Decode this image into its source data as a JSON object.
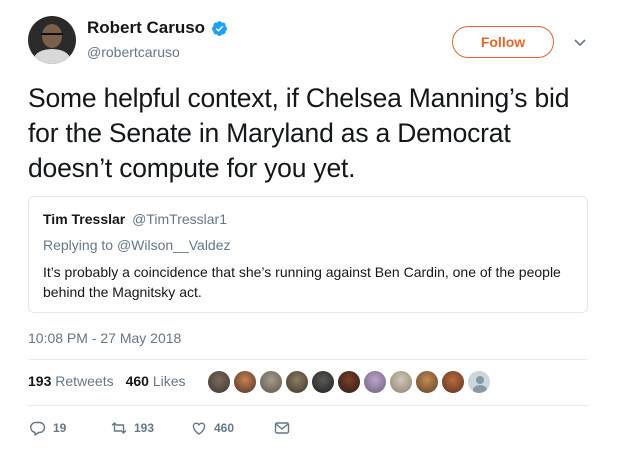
{
  "author": {
    "name": "Robert Caruso",
    "handle": "@robertcaruso",
    "verified_icon": "verified-badge-icon"
  },
  "follow_label": "Follow",
  "tweet_text": "Some helpful context, if Chelsea Manning’s bid for the Senate in Maryland as a Democrat doesn’t compute for you yet.",
  "quote": {
    "name": "Tim Tresslar",
    "handle": "@TimTresslar1",
    "reply_prefix": "Replying to",
    "reply_to": "@Wilson__Valdez",
    "text": "It’s probably a coincidence that she’s running against Ben Cardin, one of the people behind the Magnitsky act."
  },
  "timestamp": "10:08 PM - 27 May 2018",
  "stats": {
    "retweets_count": "193",
    "retweets_label": "Retweets",
    "likes_count": "460",
    "likes_label": "Likes"
  },
  "actions": {
    "reply_count": "19",
    "retweet_count": "193",
    "like_count": "460"
  },
  "colors": {
    "follow_accent": "#e0662c",
    "verified": "#1da1f2",
    "muted_text": "#657786"
  }
}
